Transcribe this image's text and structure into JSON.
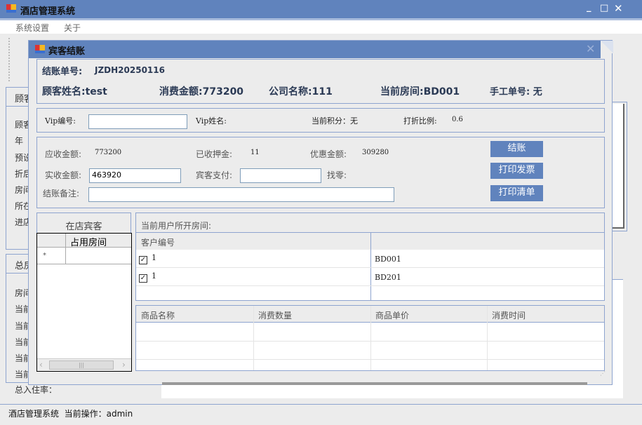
{
  "app": {
    "title": "酒店管理系统",
    "menu": [
      "系统设置",
      "关于"
    ],
    "left_group1": {
      "title": "顾客",
      "labels": [
        "顾客",
        "年",
        "预设",
        "折后",
        "房间",
        "所在",
        "进店"
      ]
    },
    "left_group2": {
      "title": "总房",
      "labels": [
        "房间",
        "当前",
        "当前",
        "当前",
        "当前",
        "当前",
        "总入住率："
      ]
    },
    "status": "酒店管理系统  当前操作：admin"
  },
  "dialog": {
    "title": "宾客结账",
    "bill_no_label": "结账单号:",
    "bill_no": "JZDH20250116",
    "guest_name": "顾客姓名:test",
    "consume_amount": "消费金额:773200",
    "company": "公司名称:111",
    "current_room": "当前房间:BD001",
    "manual_no": "手工单号: 无",
    "vip_no_label": "Vip编号:",
    "vip_no": "",
    "vip_name_label": "Vip姓名:",
    "points": "当前积分：无",
    "discount_label": "打折比例:",
    "discount": "0.6",
    "receivable_label": "应收金额:",
    "receivable": "773200",
    "deposit_label": "已收押金:",
    "deposit": "11",
    "discount_amount_label": "优惠金额:",
    "discount_amount": "309280",
    "actual_label": "实收金额:",
    "actual": "463920",
    "pay_label": "宾客支付:",
    "pay": "",
    "change_label": "找零:",
    "note_label": "结账备注:",
    "note": "",
    "buttons": {
      "checkout": "结账",
      "print_invoice": "打印发票",
      "print_list": "打印清单"
    },
    "in_store": {
      "title": "在店宾客",
      "column": "占用房间",
      "new_row_marker": "*"
    },
    "rooms": {
      "title": "当前用户所开房间:",
      "columns": [
        "客户编号",
        ""
      ],
      "rows": [
        {
          "checked": true,
          "id": "1",
          "room": "BD001"
        },
        {
          "checked": true,
          "id": "1",
          "room": "BD201"
        }
      ]
    },
    "goods": {
      "columns": [
        "商品名称",
        "消费数量",
        "商品单价",
        "消费时间"
      ]
    }
  }
}
